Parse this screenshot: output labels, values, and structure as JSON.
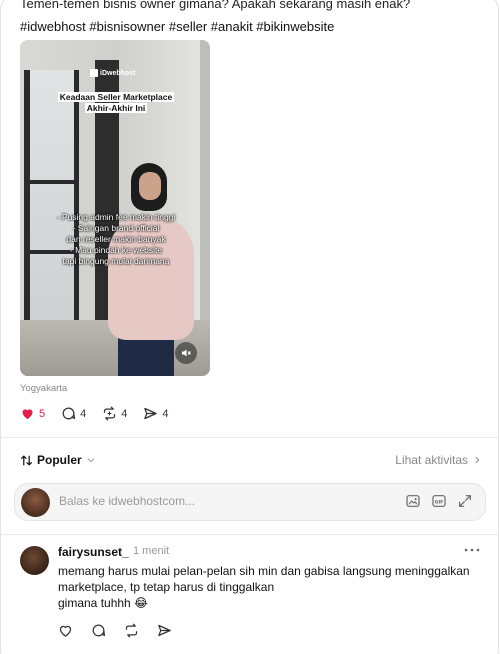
{
  "post": {
    "cut_text": "Temen-temen bisnis owner gimana? Apakah sekarang masih enak?",
    "hashtags": "#idwebhost #bisnisowner #seller #anakit #bikinwebsite",
    "video": {
      "logo": "iDwebhost",
      "title_line1": "Keadaan Seller Marketplace",
      "title_line2": "Akhir-Akhir Ini",
      "caption_line1": "- Pusing admin fee makin tinggi",
      "caption_line2": "- Saingan brand official",
      "caption_line3": "dan reseller makin banyak",
      "caption_line4": "- Mau pindah ke website",
      "caption_line5": "tapi bingung mulai darimana"
    },
    "location": "Yogyakarta",
    "likes": "5",
    "replies": "4",
    "reposts": "4",
    "shares": "4"
  },
  "sort": {
    "label": "Populer",
    "activity_label": "Lihat aktivitas"
  },
  "reply": {
    "placeholder": "Balas ke idwebhostcom..."
  },
  "comment": {
    "username": "fairysunset_",
    "time": "1 menit",
    "line1": "memang harus mulai pelan-pelan sih min dan gabisa langsung meninggalkan",
    "line2": "marketplace, tp tetap harus di tinggalkan",
    "line3": "gimana tuhhh 😂"
  },
  "colors": {
    "like": "#e11d48",
    "muted": "#888888"
  },
  "icons": [
    "heart-icon",
    "comment-icon",
    "repost-icon",
    "share-icon",
    "sort-icon",
    "chevron-down-icon",
    "chevron-right-icon",
    "image-icon",
    "gif-icon",
    "expand-icon",
    "mute-icon",
    "more-icon"
  ]
}
